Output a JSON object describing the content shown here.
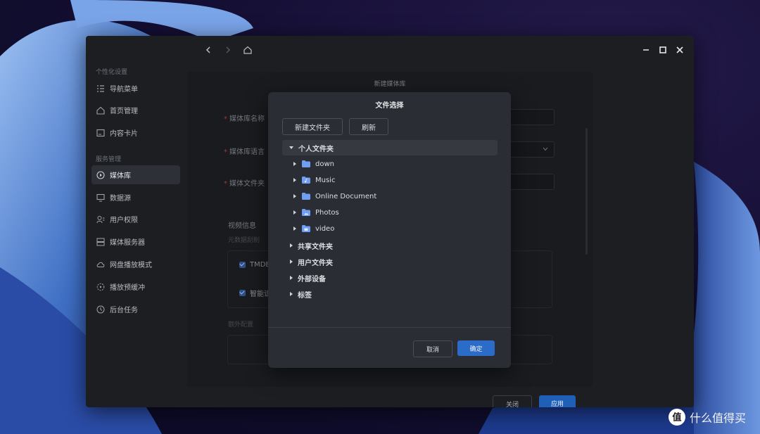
{
  "sidebar": {
    "section_personal": "个性化设置",
    "section_service": "服务管理",
    "items": [
      {
        "label": "导航菜单",
        "icon": "list-icon"
      },
      {
        "label": "首页管理",
        "icon": "home-icon"
      },
      {
        "label": "内容卡片",
        "icon": "card-icon"
      },
      {
        "label": "媒体库",
        "icon": "media-library-icon",
        "active": true
      },
      {
        "label": "数据源",
        "icon": "monitor-icon"
      },
      {
        "label": "用户权限",
        "icon": "user-icon"
      },
      {
        "label": "媒体服务器",
        "icon": "server-icon"
      },
      {
        "label": "网盘播放模式",
        "icon": "cloud-play-icon"
      },
      {
        "label": "播放预缓冲",
        "icon": "buffer-icon"
      },
      {
        "label": "后台任务",
        "icon": "clock-icon"
      }
    ]
  },
  "library_dialog": {
    "title": "新建媒体库",
    "name_label": "媒体库名称",
    "language_label": "媒体库语言",
    "folder_label": "媒体文件夹",
    "video_info": "视频信息",
    "metadata_partial": "元数据刮削",
    "option1": "TMDB",
    "option2": "智能识别",
    "extra": "额外配置",
    "close": "关闭",
    "apply": "应用"
  },
  "file_dialog": {
    "title": "文件选择",
    "new_folder": "新建文件夹",
    "refresh": "刷新",
    "tree": {
      "personal": "个人文件夹",
      "children": [
        "down",
        "Music",
        "Online Document",
        "Photos",
        "video"
      ],
      "shared": "共享文件夹",
      "users": "用户文件夹",
      "external": "外部设备",
      "tags": "标签"
    },
    "cancel": "取消",
    "confirm": "确定"
  },
  "watermark": {
    "text": "什么值得买",
    "logo_char": "值"
  },
  "colors": {
    "accent": "#2b6cc9",
    "window_bg": "#1c1e22",
    "dialog_bg": "#2a2d33"
  }
}
